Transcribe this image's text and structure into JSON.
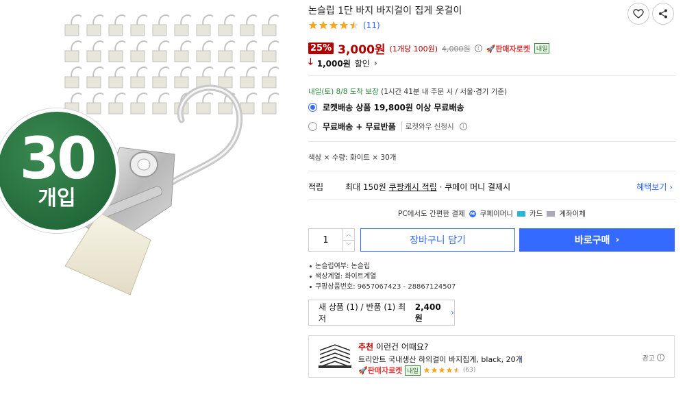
{
  "product": {
    "title": "논슬립 1단 바지 바지걸이 집게 옷걸이",
    "rating": 4.5,
    "review_count": "(11)",
    "badge_number": "30",
    "badge_text": "개입"
  },
  "price": {
    "discount_rate": "25%",
    "sale_price": "3,000원",
    "unit_price": "(1개당 100원)",
    "original_price": "4,000원",
    "seller_rocket": "판매자로켓",
    "tomorrow_tag": "내일",
    "discount_amount": "1,000원",
    "discount_label": "할인"
  },
  "delivery": {
    "arrival": "내일(토) 8/8",
    "guarantee": "도착 보장",
    "condition": "(1시간 41분 내 주문 시 / 서울·경기 기준)",
    "options": [
      {
        "label": "로켓배송 상품 19,800원 이상 무료배송",
        "note": "",
        "selected": true
      },
      {
        "label": "무료배송 + 무료반품",
        "note": "로켓와우 신청시",
        "selected": false
      }
    ]
  },
  "option_summary": "색상 × 수량: 화이트 × 30개",
  "points": {
    "label": "적립",
    "text_prefix": "최대 150원",
    "link": "쿠팡캐시 적립",
    "text_suffix": "· 쿠페이 머니 결제시",
    "benefits": "혜택보기"
  },
  "payment": {
    "title": "PC에서도 간편한 결제",
    "methods": [
      "쿠페이머니",
      "카드",
      "계좌이체"
    ]
  },
  "purchase": {
    "quantity": "1",
    "cart_label": "장바구니 담기",
    "buy_label": "바로구매"
  },
  "specs": [
    "논슬립여부: 논슬립",
    "색상계열: 화이트계열",
    "쿠팡상품번호: 9657067423 - 28867124507"
  ],
  "new_used": {
    "prefix": "새 상품 (1) / 반품 (1) 최저",
    "price": "2,400원"
  },
  "recommendation": {
    "head_red": "추천",
    "head": "이런건 어때요?",
    "name": "트리안트 국내생산 하의걸이 바지집게, black, 20개",
    "seller": "판매자로켓",
    "tag": "내일",
    "rating": 4.5,
    "reviews": "(63)",
    "ad_label": "광고"
  },
  "colors": {
    "accent_blue": "#346aff",
    "price_red": "#ae0000",
    "badge_green": "#236b3a"
  }
}
